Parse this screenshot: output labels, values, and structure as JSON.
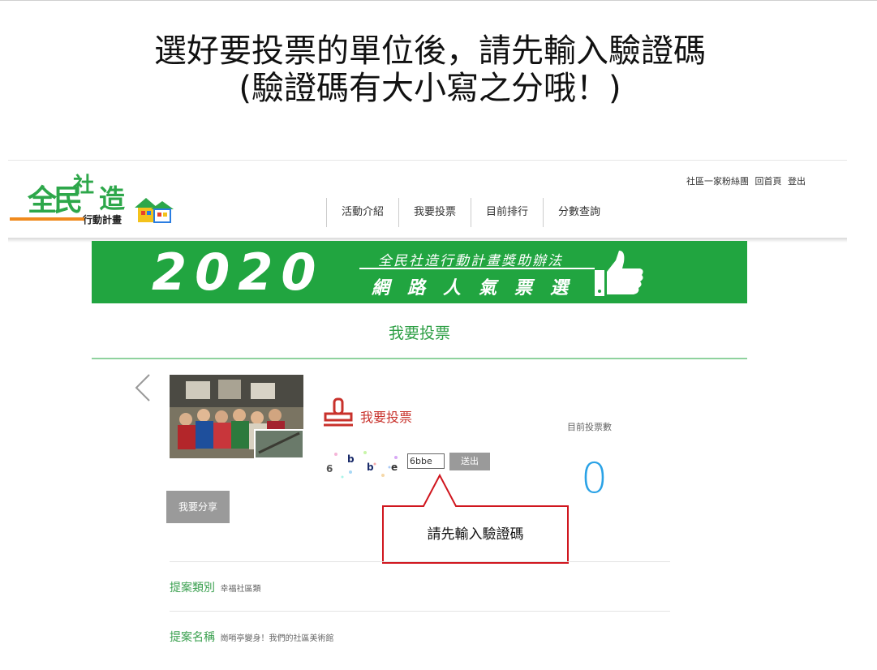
{
  "slide": {
    "instruction_line1": "選好要投票的單位後，請先輸入驗證碼",
    "instruction_line2": "(驗證碼有大小寫之分哦！)"
  },
  "header": {
    "logo": {
      "char1": "全民",
      "char2": "社",
      "char3": "造",
      "tagline": "行動計畫"
    },
    "nav": [
      "活動介紹",
      "我要投票",
      "目前排行",
      "分數查詢"
    ],
    "top_links": [
      "社區一家粉絲團",
      "回首頁",
      "登出"
    ]
  },
  "banner": {
    "year": "2020",
    "subtitle_top": "全民社造行動計畫獎助辦法",
    "subtitle_bottom": "網路人氣票選"
  },
  "section_title": "我要投票",
  "vote_panel": {
    "vote_label": "我要投票",
    "captcha_chars": [
      "6",
      "b",
      "b",
      "e"
    ],
    "captcha_input_value": "6bbe",
    "submit_label": "送出",
    "count_label": "目前投票數",
    "count_value": "0",
    "share_label": "我要分享"
  },
  "callout": {
    "text": "請先輸入驗證碼",
    "border_color": "#d0161e"
  },
  "details": {
    "category_key": "提案類別",
    "category_value": "幸福社區類",
    "name_key": "提案名稱",
    "name_value": "崗哨亭變身！我們的社區美術館"
  },
  "colors": {
    "brand_green": "#21a540",
    "vote_red": "#c8312b",
    "count_blue": "#2aa2e6"
  }
}
